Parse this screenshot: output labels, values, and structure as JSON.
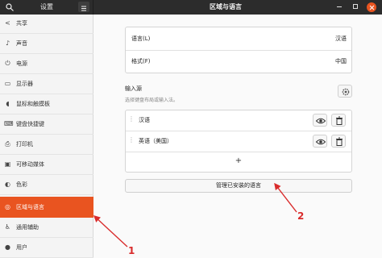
{
  "header": {
    "left_title": "设置",
    "main_title": "区域与语言"
  },
  "sidebar": {
    "items": [
      {
        "label": "共享",
        "icon": "share-icon",
        "glyph": "<"
      },
      {
        "label": "声音",
        "icon": "music-note-icon",
        "glyph": "♪"
      },
      {
        "label": "电源",
        "icon": "power-icon",
        "glyph": "⏻"
      },
      {
        "label": "显示器",
        "icon": "display-icon",
        "glyph": "▭"
      },
      {
        "label": "鼠标和触摸板",
        "icon": "mouse-icon",
        "glyph": "◖"
      },
      {
        "label": "键盘快捷键",
        "icon": "keyboard-icon",
        "glyph": "⌨"
      },
      {
        "label": "打印机",
        "icon": "printer-icon",
        "glyph": "⎙"
      },
      {
        "label": "可移动媒体",
        "icon": "removable-media-icon",
        "glyph": "▣"
      },
      {
        "label": "色彩",
        "icon": "color-icon",
        "glyph": "◐"
      },
      {
        "label": "区域与语言",
        "icon": "globe-icon",
        "glyph": "◎",
        "active": true
      },
      {
        "label": "通用辅助",
        "icon": "accessibility-icon",
        "glyph": "♿"
      },
      {
        "label": "用户",
        "icon": "user-icon",
        "glyph": "●"
      }
    ]
  },
  "main": {
    "language_label": "语言(L)",
    "language_value": "汉语",
    "format_label": "格式(F)",
    "format_value": "中国",
    "input_sources_title": "输入源",
    "input_sources_subtitle": "选择键盘布局或输入法。",
    "input_sources": [
      {
        "label": "汉语"
      },
      {
        "label": "英语（美国）"
      }
    ],
    "add_symbol": "+",
    "manage_button": "管理已安装的语言"
  },
  "annotations": {
    "marker_1": "1",
    "marker_2": "2",
    "color": "#d92c2c"
  },
  "colors": {
    "accent": "#e95420",
    "headerbar": "#2c2c2c"
  }
}
